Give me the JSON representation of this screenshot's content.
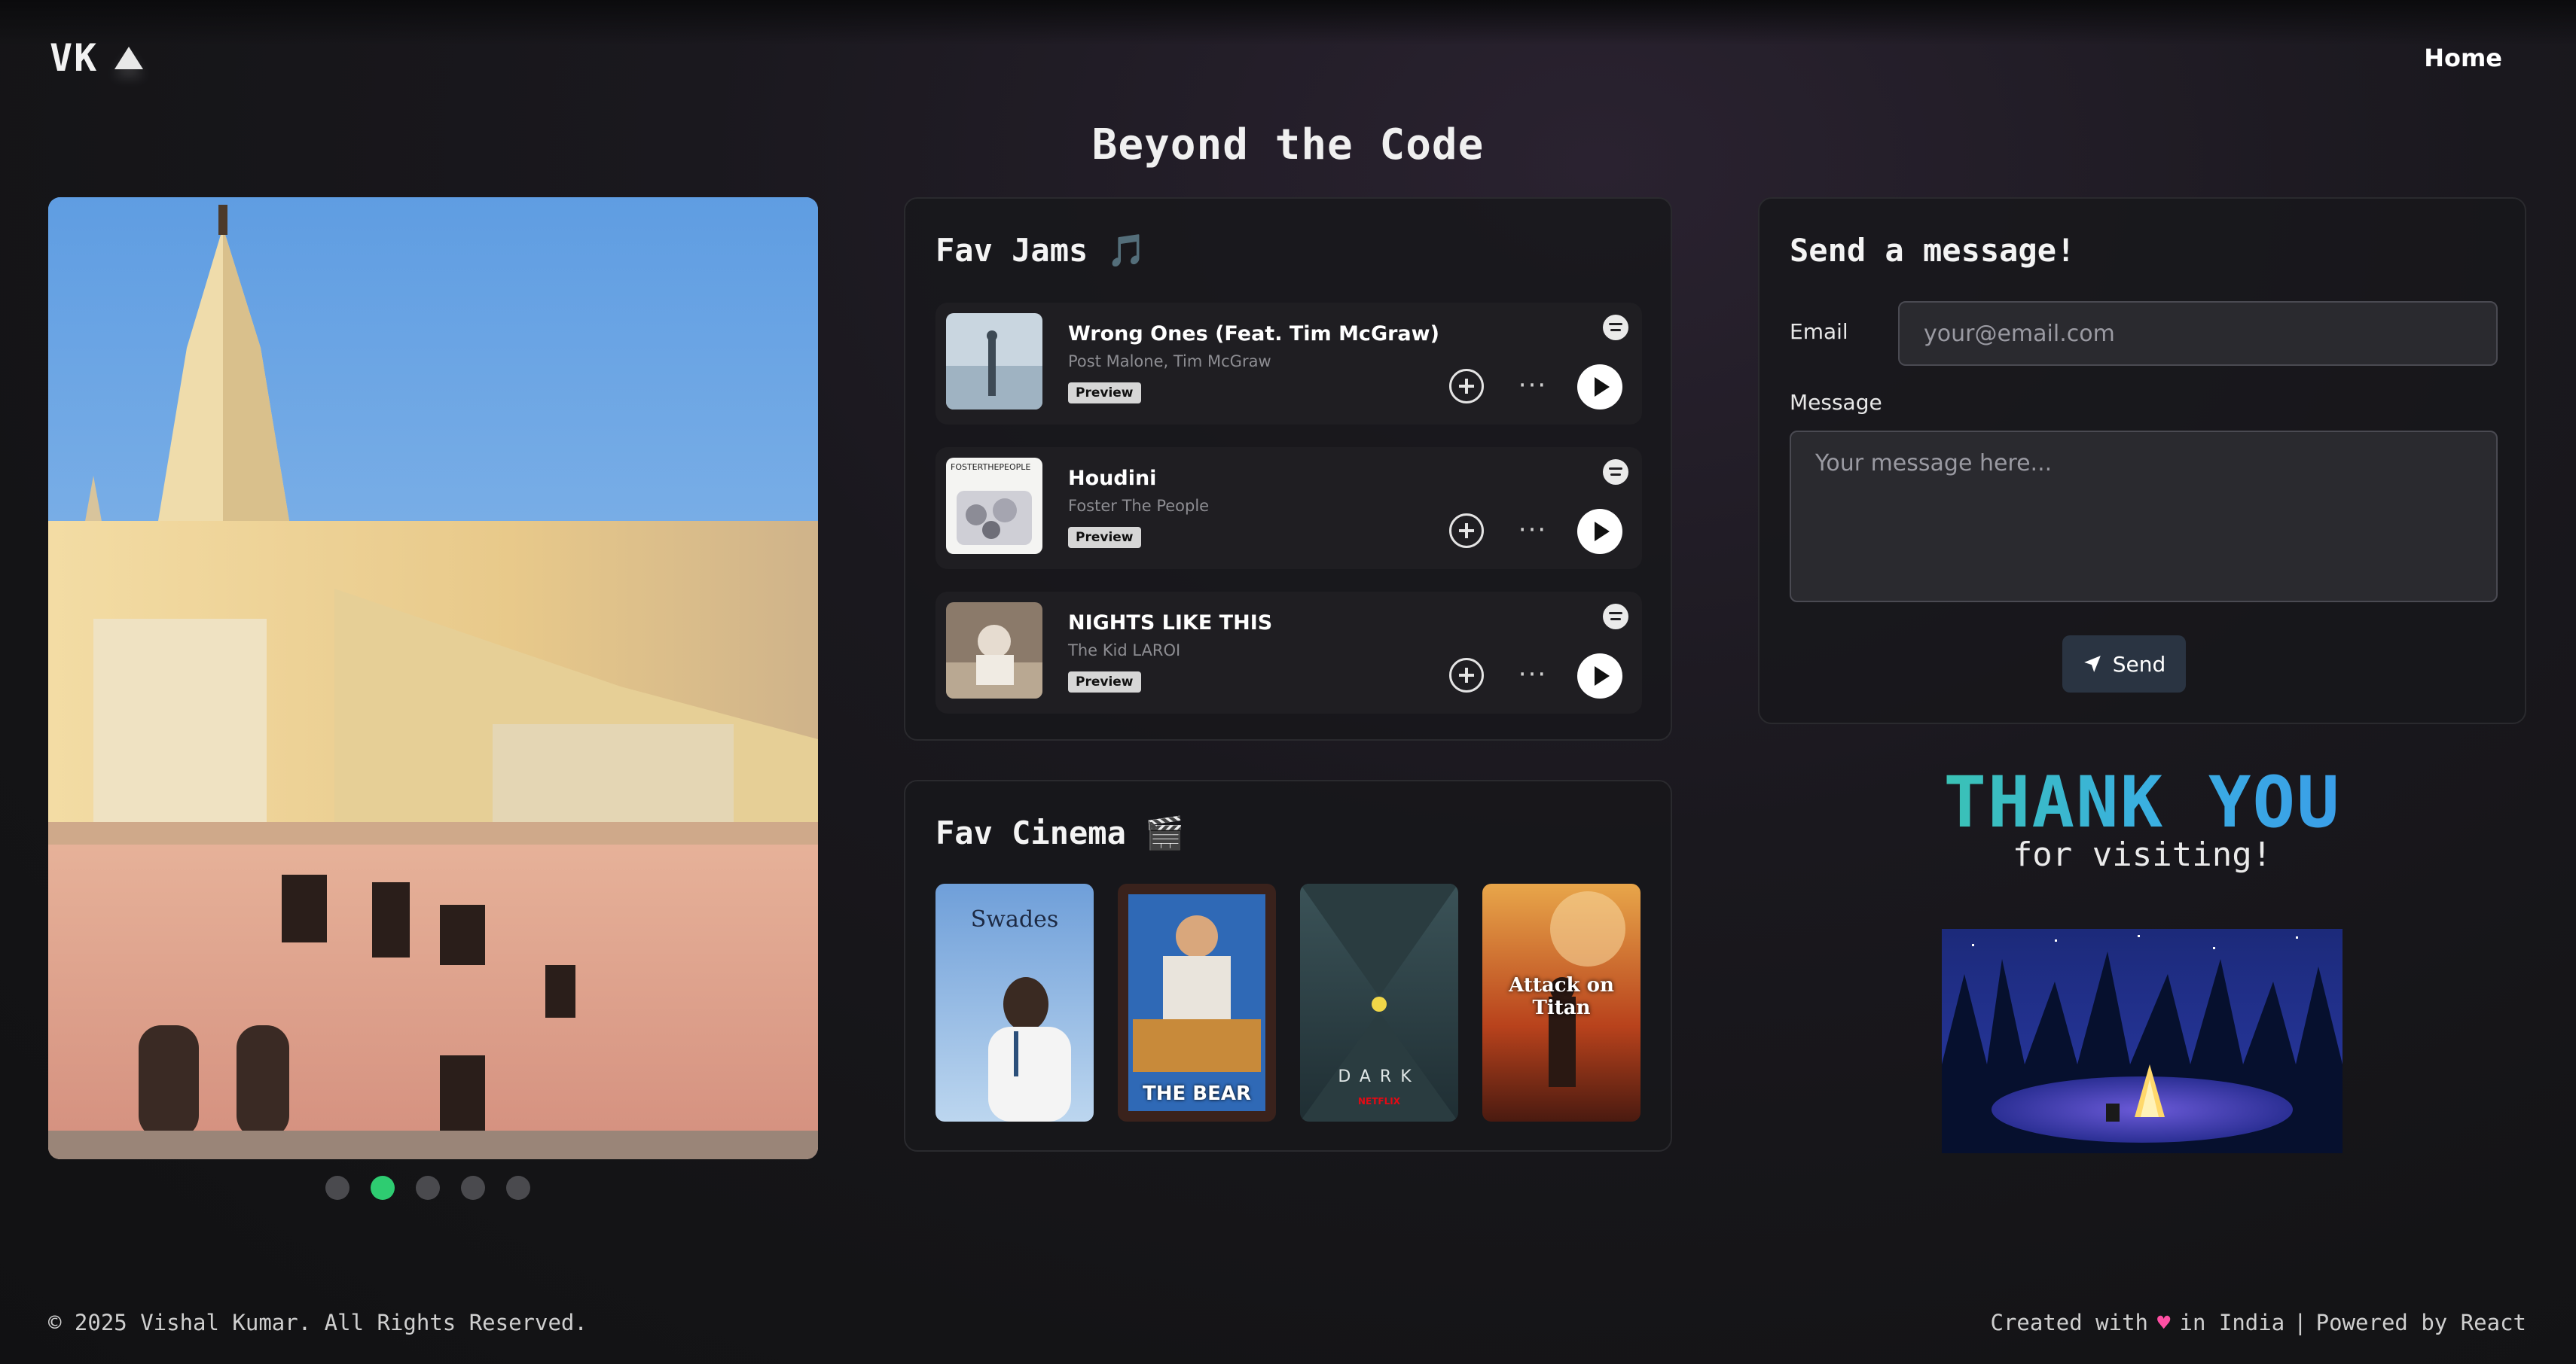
{
  "header": {
    "logo_text": "VK",
    "nav_home": "Home"
  },
  "page_title": "Beyond the Code",
  "carousel": {
    "slide_count": 5,
    "active_index": 1
  },
  "songs_card": {
    "title": "Fav Jams 🎵",
    "preview_label": "Preview",
    "songs": [
      {
        "title": "Wrong Ones (Feat. Tim McGraw)",
        "artist": "Post Malone, Tim McGraw"
      },
      {
        "title": "Houdini",
        "artist": "Foster The People",
        "cover_text": "FOSTERTHEPEOPLE"
      },
      {
        "title": "NIGHTS LIKE THIS",
        "artist": "The Kid LAROI"
      }
    ]
  },
  "cinema_card": {
    "title": "Fav Cinema 🎬",
    "posters": [
      {
        "label": "Swades"
      },
      {
        "label": "THE BEAR"
      },
      {
        "label": "DARK",
        "sub": "NETFLIX"
      },
      {
        "label": "Attack on Titan"
      }
    ]
  },
  "message_card": {
    "title": "Send a message!",
    "email_label": "Email",
    "email_placeholder": "your@email.com",
    "message_label": "Message",
    "message_placeholder": "Your message here...",
    "send_label": "Send"
  },
  "thanks": {
    "headline": "THANK YOU",
    "sub": "for visiting!"
  },
  "footer": {
    "copyright": "© 2025 Vishal Kumar. All Rights Reserved.",
    "created_prefix": "Created with",
    "created_suffix": "in India",
    "separator": "|",
    "powered": "Powered by React"
  },
  "colors": {
    "accent_green": "#2ecc71",
    "heart": "#ff4fa3"
  }
}
